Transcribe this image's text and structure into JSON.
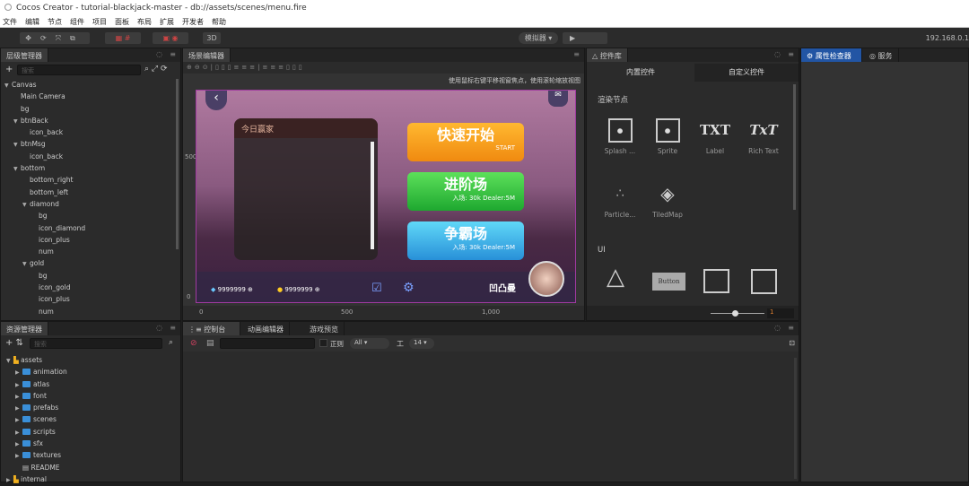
{
  "window": {
    "title": "Cocos Creator - tutorial-blackjack-master - db://assets/scenes/menu.fire"
  },
  "menu": [
    "文件",
    "编辑",
    "节点",
    "组件",
    "项目",
    "面板",
    "布局",
    "扩展",
    "开发者",
    "帮助"
  ],
  "toolbar": {
    "mode3d": "3D",
    "simulator": "模拟器 ▾",
    "play_icon": "play-icon",
    "ip": "192.168.0.1"
  },
  "hierarchy": {
    "title": "层级管理器",
    "search_placeholder": "搜索",
    "nodes": [
      {
        "label": "Canvas",
        "depth": 0,
        "arrow": true
      },
      {
        "label": "Main Camera",
        "depth": 1
      },
      {
        "label": "bg",
        "depth": 1
      },
      {
        "label": "btnBack",
        "depth": 1,
        "arrow": true
      },
      {
        "label": "icon_back",
        "depth": 2
      },
      {
        "label": "btnMsg",
        "depth": 1,
        "arrow": true
      },
      {
        "label": "icon_back",
        "depth": 2
      },
      {
        "label": "bottom",
        "depth": 1,
        "arrow": true
      },
      {
        "label": "bottom_right",
        "depth": 2
      },
      {
        "label": "bottom_left",
        "depth": 2
      },
      {
        "label": "diamond",
        "depth": 2,
        "arrow": true
      },
      {
        "label": "bg",
        "depth": 3
      },
      {
        "label": "icon_diamond",
        "depth": 3
      },
      {
        "label": "icon_plus",
        "depth": 3
      },
      {
        "label": "num",
        "depth": 3
      },
      {
        "label": "gold",
        "depth": 2,
        "arrow": true
      },
      {
        "label": "bg",
        "depth": 3
      },
      {
        "label": "icon_gold",
        "depth": 3
      },
      {
        "label": "icon_plus",
        "depth": 3
      },
      {
        "label": "num",
        "depth": 3
      }
    ]
  },
  "scene": {
    "title": "场景编辑器",
    "hint": "使用鼠标右键平移视窗焦点，使用滚轮缩放视图",
    "ruler_y": [
      "500",
      "0"
    ],
    "ruler_x": [
      "0",
      "500",
      "1,000"
    ],
    "game": {
      "panel_title": "今日赢家",
      "quick_start": "快速开始",
      "quick_start_en": "START",
      "advanced": "进阶场",
      "advanced_sub": "入场: 30k  Dealer:5M",
      "contest": "争霸场",
      "contest_sub": "入场: 30k  Dealer:5M",
      "diamonds": "9999999",
      "gold": "9999999",
      "player_name": "凹凸曼"
    }
  },
  "components": {
    "title": "控件库",
    "tabs": [
      "内置控件",
      "自定义控件"
    ],
    "section_render": "渲染节点",
    "render": [
      "Splash ...",
      "Sprite",
      "Label",
      "Rich Text",
      "Particle...",
      "TiledMap"
    ],
    "section_ui": "UI",
    "button_preview": "Button",
    "zoom_value": "1"
  },
  "inspector": {
    "tabs": [
      "属性检查器",
      "服务"
    ]
  },
  "assets": {
    "title": "资源管理器",
    "search_placeholder": "搜索",
    "root": "assets",
    "items": [
      "animation",
      "atlas",
      "font",
      "prefabs",
      "scenes",
      "scripts",
      "sfx",
      "textures"
    ],
    "file": "README",
    "internal": "internal"
  },
  "console": {
    "tabs": [
      "控制台",
      "动画编辑器",
      "游戏预览"
    ],
    "regex_label": "正则",
    "filter": "All ▾",
    "font_size": "14 ▾"
  },
  "colors": {
    "accent": "#2255a4",
    "panel": "#2b2b2b"
  }
}
